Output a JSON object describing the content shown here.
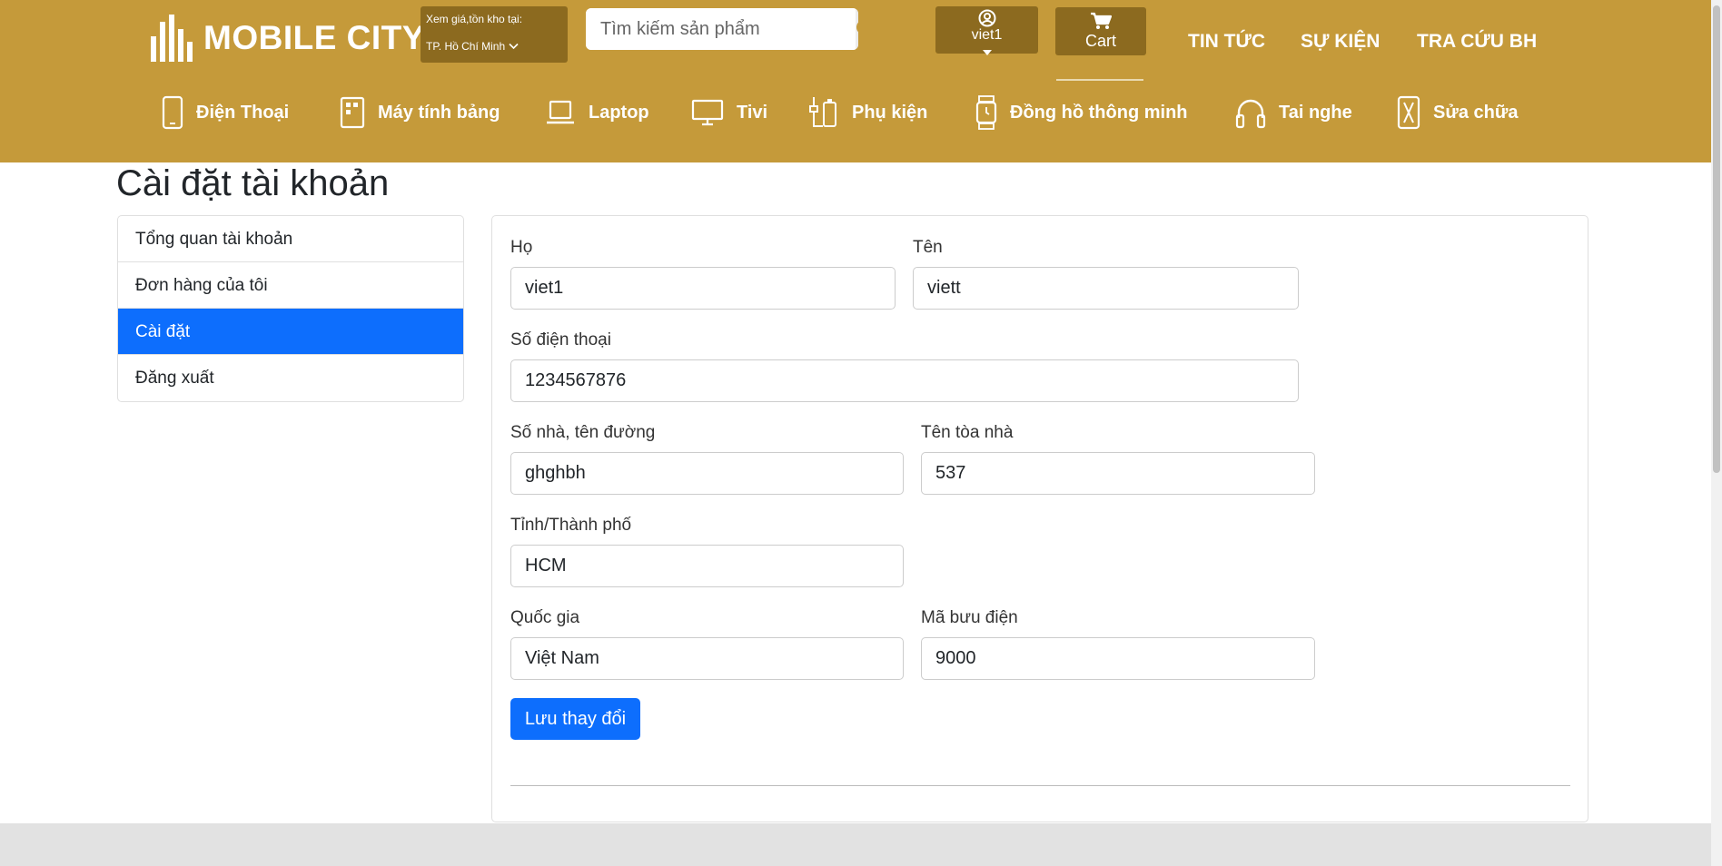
{
  "header": {
    "logo_text": "MOBILE CITY",
    "location_label": "Xem giá,tồn kho tại:",
    "location_value": "TP. Hồ Chí Minh",
    "search_placeholder": "Tìm kiếm sản phẩm",
    "user_name": "viet1",
    "cart_label": "Cart",
    "links": [
      "TIN TỨC",
      "SỰ KIỆN",
      "TRA CỨU BH"
    ],
    "brand_color": "#c59a3a"
  },
  "nav": [
    {
      "label": "Điện Thoại",
      "icon": "phone-icon"
    },
    {
      "label": "Máy tính bảng",
      "icon": "tablet-icon"
    },
    {
      "label": "Laptop",
      "icon": "laptop-icon"
    },
    {
      "label": "Tivi",
      "icon": "tv-icon"
    },
    {
      "label": "Phụ kiện",
      "icon": "accessory-icon"
    },
    {
      "label": "Đồng hồ thông minh",
      "icon": "smartwatch-icon"
    },
    {
      "label": "Tai nghe",
      "icon": "headphones-icon"
    },
    {
      "label": "Sửa chữa",
      "icon": "repair-icon"
    }
  ],
  "page_title": "Cài đặt tài khoản",
  "sidebar": {
    "items": [
      "Tổng quan tài khoản",
      "Đơn hàng của tôi",
      "Cài đặt",
      "Đăng xuất"
    ],
    "active": "Cài đặt"
  },
  "form": {
    "last_name": {
      "label": "Họ",
      "value": "viet1"
    },
    "first_name": {
      "label": "Tên",
      "value": "viett"
    },
    "phone": {
      "label": "Số điện thoại",
      "value": "1234567876"
    },
    "street": {
      "label": "Số nhà, tên đường",
      "value": "ghghbh"
    },
    "building": {
      "label": "Tên tòa nhà",
      "value": "537"
    },
    "city": {
      "label": "Tỉnh/Thành phố",
      "value": "HCM"
    },
    "country": {
      "label": "Quốc gia",
      "value": "Việt Nam"
    },
    "postal": {
      "label": "Mã bưu điện",
      "value": "9000"
    },
    "save_label": "Lưu thay đổi"
  }
}
